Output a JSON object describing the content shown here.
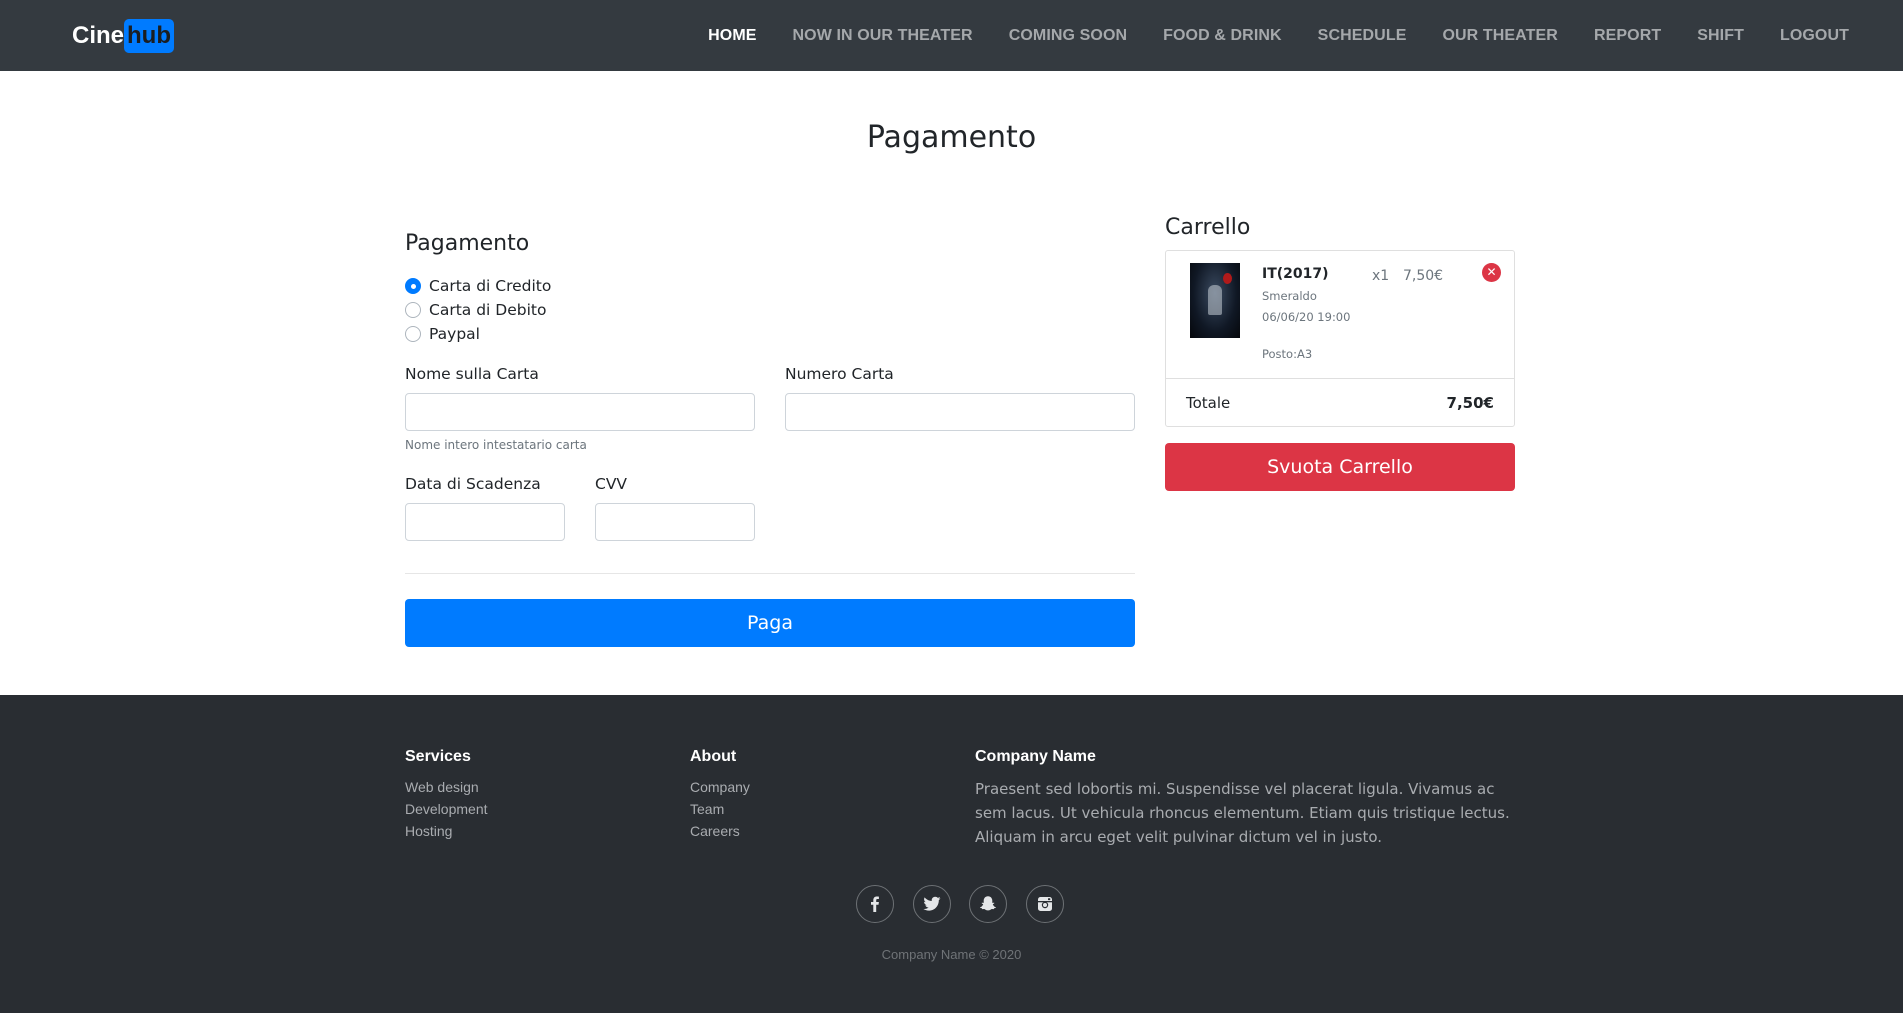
{
  "navbar": {
    "brand_part1": "Cine",
    "brand_part2": "hub",
    "links": [
      "HOME",
      "NOW IN OUR THEATER",
      "COMING SOON",
      "FOOD & DRINK",
      "SCHEDULE",
      "OUR THEATER",
      "REPORT",
      "SHIFT",
      "LOGOUT"
    ],
    "active": "HOME"
  },
  "page": {
    "title": "Pagamento"
  },
  "payment": {
    "heading": "Pagamento",
    "methods": [
      {
        "label": "Carta di Credito",
        "checked": true
      },
      {
        "label": "Carta di Debito",
        "checked": false
      },
      {
        "label": "Paypal",
        "checked": false
      }
    ],
    "name_label": "Nome sulla Carta",
    "name_value": "",
    "name_help": "Nome intero intestatario carta",
    "number_label": "Numero Carta",
    "number_value": "",
    "expiry_label": "Data di Scadenza",
    "expiry_value": "",
    "cvv_label": "CVV",
    "cvv_value": "",
    "pay_button": "Paga"
  },
  "cart": {
    "heading": "Carrello",
    "items": [
      {
        "title": "IT(2017)",
        "theater": "Smeraldo",
        "datetime": "06/06/20 19:00",
        "seat": "Posto:A3",
        "qty": "x1",
        "price": "7,50€",
        "remove_icon": "close-icon"
      }
    ],
    "total_label": "Totale",
    "total_value": "7,50€",
    "empty_button": "Svuota Carrello"
  },
  "footer": {
    "services_heading": "Services",
    "services": [
      "Web design",
      "Development",
      "Hosting"
    ],
    "about_heading": "About",
    "about": [
      "Company",
      "Team",
      "Careers"
    ],
    "company_heading": "Company Name",
    "company_text": "Praesent sed lobortis mi. Suspendisse vel placerat ligula. Vivamus ac sem lacus. Ut vehicula rhoncus elementum. Etiam quis tristique lectus. Aliquam in arcu eget velit pulvinar dictum vel in justo.",
    "social": [
      "facebook-icon",
      "twitter-icon",
      "snapchat-icon",
      "instagram-icon"
    ],
    "copyright": "Company Name © 2020"
  },
  "colors": {
    "navbar_bg": "#343a40",
    "primary": "#007bff",
    "danger": "#dc3545",
    "footer_bg": "#292d32"
  }
}
